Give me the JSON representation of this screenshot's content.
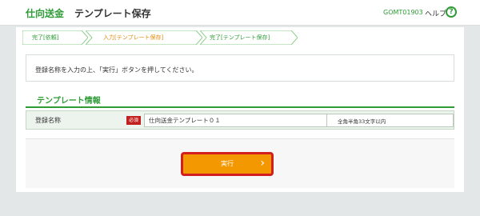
{
  "header": {
    "brand": "仕向送金",
    "title": "テンプレート保存",
    "screen_id": "GOMT01903",
    "help": "ヘルプ",
    "help_icon": "?"
  },
  "steps": [
    {
      "label": "完了[依頼]",
      "state": "done"
    },
    {
      "label": "入力[テンプレート保存]",
      "state": "current"
    },
    {
      "label": "完了[テンプレート保存]",
      "state": "todo"
    }
  ],
  "message": "登録名称を入力の上、「実行」ボタンを押してください。",
  "section": {
    "title": "テンプレート情報"
  },
  "form": {
    "label": "登録名称",
    "required": "必須",
    "value": "仕向送金テンプレート０１",
    "hint": "全角半角33文字以内"
  },
  "actions": {
    "execute": "実行",
    "chevron": "›"
  }
}
